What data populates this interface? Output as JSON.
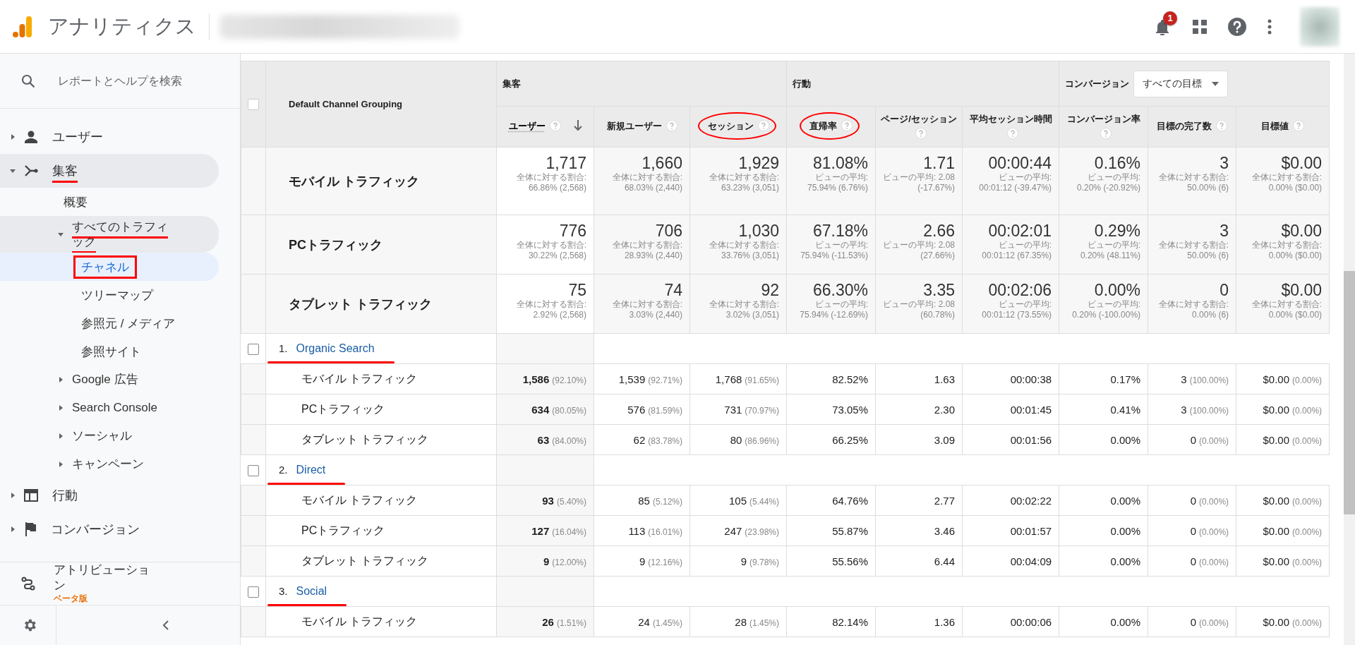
{
  "header": {
    "product": "アナリティクス",
    "notifications": "1"
  },
  "search": {
    "placeholder": "レポートとヘルプを検索"
  },
  "nav": [
    {
      "label": "ユーザー",
      "expanded": false,
      "selected": false
    },
    {
      "label": "集客",
      "expanded": true,
      "selected": false,
      "underlined": true,
      "children": [
        {
          "label": "概要",
          "kind": "page",
          "selected": false
        },
        {
          "label": "すべてのトラフィック",
          "kind": "folder",
          "expanded": true,
          "selected": false,
          "underlined": true,
          "children": [
            {
              "label": "チャネル",
              "selected": true,
              "boxed": true
            },
            {
              "label": "ツリーマップ",
              "selected": false
            },
            {
              "label": "参照元 / メディア",
              "selected": false
            },
            {
              "label": "参照サイト",
              "selected": false
            }
          ]
        },
        {
          "label": "Google 広告",
          "kind": "folder",
          "expanded": false,
          "selected": false
        },
        {
          "label": "Search Console",
          "kind": "folder",
          "expanded": false,
          "selected": false
        },
        {
          "label": "ソーシャル",
          "kind": "folder",
          "expanded": false,
          "selected": false
        },
        {
          "label": "キャンペーン",
          "kind": "folder",
          "expanded": false,
          "selected": false
        }
      ]
    },
    {
      "label": "行動",
      "expanded": false,
      "selected": false
    },
    {
      "label": "コンバージョン",
      "expanded": false,
      "selected": false
    }
  ],
  "attribution": {
    "label": "アトリビューション",
    "badge": "ベータ版"
  },
  "table": {
    "select_all": {
      "checked": false
    },
    "dimension": "Default Channel Grouping",
    "groups": [
      {
        "label": "集客",
        "columns": [
          {
            "label": "ユーザー",
            "sorted": true
          },
          {
            "label": "新規ユーザー",
            "sorted": false
          },
          {
            "label": "セッション",
            "sorted": false,
            "circled": true
          }
        ]
      },
      {
        "label": "行動",
        "columns": [
          {
            "label": "直帰率",
            "sorted": false,
            "circled": true
          },
          {
            "label": "ページ/セッション",
            "sorted": false
          },
          {
            "label": "平均セッション時間",
            "sorted": false
          }
        ]
      },
      {
        "label": "コンバージョン",
        "dropdown": "すべての目標",
        "columns": [
          {
            "label": "コンバージョン率",
            "sorted": false
          },
          {
            "label": "目標の完了数",
            "sorted": false
          },
          {
            "label": "目標値",
            "sorted": false
          }
        ]
      }
    ],
    "summary": [
      {
        "name": "モバイル トラフィック",
        "cells": [
          [
            "1,717",
            "全体に対する割合: 66.86% (2,568)"
          ],
          [
            "1,660",
            "全体に対する割合: 68.03% (2,440)"
          ],
          [
            "1,929",
            "全体に対する割合: 63.23% (3,051)"
          ],
          [
            "81.08%",
            "ビューの平均: 75.94% (6.76%)"
          ],
          [
            "1.71",
            "ビューの平均: 2.08 (-17.67%)"
          ],
          [
            "00:00:44",
            "ビューの平均: 00:01:12 (-39.47%)"
          ],
          [
            "0.16%",
            "ビューの平均: 0.20% (-20.92%)"
          ],
          [
            "3",
            "全体に対する割合: 50.00% (6)"
          ],
          [
            "$0.00",
            "全体に対する割合: 0.00% ($0.00)"
          ]
        ]
      },
      {
        "name": "PCトラフィック",
        "cells": [
          [
            "776",
            "全体に対する割合: 30.22% (2,568)"
          ],
          [
            "706",
            "全体に対する割合: 28.93% (2,440)"
          ],
          [
            "1,030",
            "全体に対する割合: 33.76% (3,051)"
          ],
          [
            "67.18%",
            "ビューの平均: 75.94% (-11.53%)"
          ],
          [
            "2.66",
            "ビューの平均: 2.08 (27.66%)"
          ],
          [
            "00:02:01",
            "ビューの平均: 00:01:12 (67.35%)"
          ],
          [
            "0.29%",
            "ビューの平均: 0.20% (48.11%)"
          ],
          [
            "3",
            "全体に対する割合: 50.00% (6)"
          ],
          [
            "$0.00",
            "全体に対する割合: 0.00% ($0.00)"
          ]
        ]
      },
      {
        "name": "タブレット トラフィック",
        "cells": [
          [
            "75",
            "全体に対する割合: 2.92% (2,568)"
          ],
          [
            "74",
            "全体に対する割合: 3.03% (2,440)"
          ],
          [
            "92",
            "全体に対する割合: 3.02% (3,051)"
          ],
          [
            "66.30%",
            "ビューの平均: 75.94% (-12.69%)"
          ],
          [
            "3.35",
            "ビューの平均: 2.08 (60.78%)"
          ],
          [
            "00:02:06",
            "ビューの平均: 00:01:12 (73.55%)"
          ],
          [
            "0.00%",
            "ビューの平均: 0.20% (-100.00%)"
          ],
          [
            "0",
            "全体に対する割合: 0.00% (6)"
          ],
          [
            "$0.00",
            "全体に対する割合: 0.00% ($0.00)"
          ]
        ]
      }
    ],
    "channels": [
      {
        "index": "1.",
        "name": "Organic Search",
        "checked": false,
        "underlined": true,
        "rows": [
          {
            "name": "モバイル トラフィック",
            "cells": [
              [
                "1,586",
                "(92.10%)"
              ],
              [
                "1,539",
                "(92.71%)"
              ],
              [
                "1,768",
                "(91.65%)"
              ],
              [
                "82.52%"
              ],
              [
                "1.63"
              ],
              [
                "00:00:38"
              ],
              [
                "0.17%"
              ],
              [
                "3",
                "(100.00%)"
              ],
              [
                "$0.00",
                "(0.00%)"
              ]
            ]
          },
          {
            "name": "PCトラフィック",
            "cells": [
              [
                "634",
                "(80.05%)"
              ],
              [
                "576",
                "(81.59%)"
              ],
              [
                "731",
                "(70.97%)"
              ],
              [
                "73.05%"
              ],
              [
                "2.30"
              ],
              [
                "00:01:45"
              ],
              [
                "0.41%"
              ],
              [
                "3",
                "(100.00%)"
              ],
              [
                "$0.00",
                "(0.00%)"
              ]
            ]
          },
          {
            "name": "タブレット トラフィック",
            "cells": [
              [
                "63",
                "(84.00%)"
              ],
              [
                "62",
                "(83.78%)"
              ],
              [
                "80",
                "(86.96%)"
              ],
              [
                "66.25%"
              ],
              [
                "3.09"
              ],
              [
                "00:01:56"
              ],
              [
                "0.00%"
              ],
              [
                "0",
                "(0.00%)"
              ],
              [
                "$0.00",
                "(0.00%)"
              ]
            ]
          }
        ]
      },
      {
        "index": "2.",
        "name": "Direct",
        "checked": false,
        "underlined": true,
        "rows": [
          {
            "name": "モバイル トラフィック",
            "cells": [
              [
                "93",
                "(5.40%)"
              ],
              [
                "85",
                "(5.12%)"
              ],
              [
                "105",
                "(5.44%)"
              ],
              [
                "64.76%"
              ],
              [
                "2.77"
              ],
              [
                "00:02:22"
              ],
              [
                "0.00%"
              ],
              [
                "0",
                "(0.00%)"
              ],
              [
                "$0.00",
                "(0.00%)"
              ]
            ]
          },
          {
            "name": "PCトラフィック",
            "cells": [
              [
                "127",
                "(16.04%)"
              ],
              [
                "113",
                "(16.01%)"
              ],
              [
                "247",
                "(23.98%)"
              ],
              [
                "55.87%"
              ],
              [
                "3.46"
              ],
              [
                "00:01:57"
              ],
              [
                "0.00%"
              ],
              [
                "0",
                "(0.00%)"
              ],
              [
                "$0.00",
                "(0.00%)"
              ]
            ]
          },
          {
            "name": "タブレット トラフィック",
            "cells": [
              [
                "9",
                "(12.00%)"
              ],
              [
                "9",
                "(12.16%)"
              ],
              [
                "9",
                "(9.78%)"
              ],
              [
                "55.56%"
              ],
              [
                "6.44"
              ],
              [
                "00:04:09"
              ],
              [
                "0.00%"
              ],
              [
                "0",
                "(0.00%)"
              ],
              [
                "$0.00",
                "(0.00%)"
              ]
            ]
          }
        ]
      },
      {
        "index": "3.",
        "name": "Social",
        "checked": false,
        "underlined": true,
        "rows": [
          {
            "name": "モバイル トラフィック",
            "cells": [
              [
                "26",
                "(1.51%)"
              ],
              [
                "24",
                "(1.45%)"
              ],
              [
                "28",
                "(1.45%)"
              ],
              [
                "82.14%"
              ],
              [
                "1.36"
              ],
              [
                "00:00:06"
              ],
              [
                "0.00%"
              ],
              [
                "0",
                "(0.00%)"
              ],
              [
                "$0.00",
                "(0.00%)"
              ]
            ]
          }
        ]
      }
    ]
  }
}
